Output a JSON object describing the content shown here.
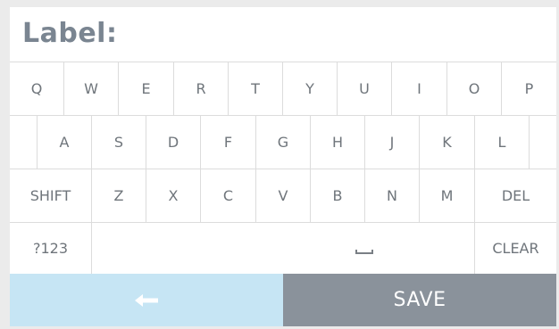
{
  "label_field": {
    "prompt": "Label:"
  },
  "keyboard": {
    "row1": [
      "Q",
      "W",
      "E",
      "R",
      "T",
      "Y",
      "U",
      "I",
      "O",
      "P"
    ],
    "row2": [
      "A",
      "S",
      "D",
      "F",
      "G",
      "H",
      "J",
      "K",
      "L"
    ],
    "row3": {
      "shift": "SHIFT",
      "letters": [
        "Z",
        "X",
        "C",
        "V",
        "B",
        "N",
        "M"
      ],
      "delete": "DEL"
    },
    "row4": {
      "mode": "?123",
      "clear": "CLEAR"
    }
  },
  "actions": {
    "back_icon": "left-arrow-icon",
    "save": "SAVE"
  },
  "colors": {
    "back_bg": "#c6e5f4",
    "save_bg": "#8a929b",
    "key_text": "#6f757b"
  }
}
